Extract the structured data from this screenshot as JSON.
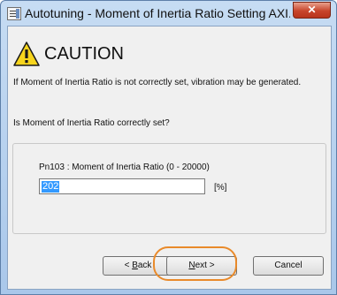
{
  "window": {
    "title": "Autotuning - Moment of Inertia Ratio Setting AXI...",
    "close_glyph": "✕"
  },
  "content": {
    "heading": "CAUTION",
    "warning_message": "If Moment of Inertia Ratio is not correctly set, vibration may be generated.",
    "question": "Is Moment of Inertia Ratio correctly set?"
  },
  "parameter": {
    "label": "Pn103 : Moment of Inertia Ratio (0 - 20000)",
    "value": "202",
    "unit": "[%]"
  },
  "buttons": {
    "back_prefix": "< ",
    "back_mnemonic": "B",
    "back_rest": "ack",
    "next_mnemonic": "N",
    "next_rest": "ext >",
    "cancel": "Cancel"
  },
  "icons": {
    "app": "settings-dialog-icon",
    "warning": "warning-triangle-icon"
  },
  "colors": {
    "highlight": "#e98a2a",
    "selection": "#3399ff",
    "warning_yellow": "#f7d51d"
  }
}
